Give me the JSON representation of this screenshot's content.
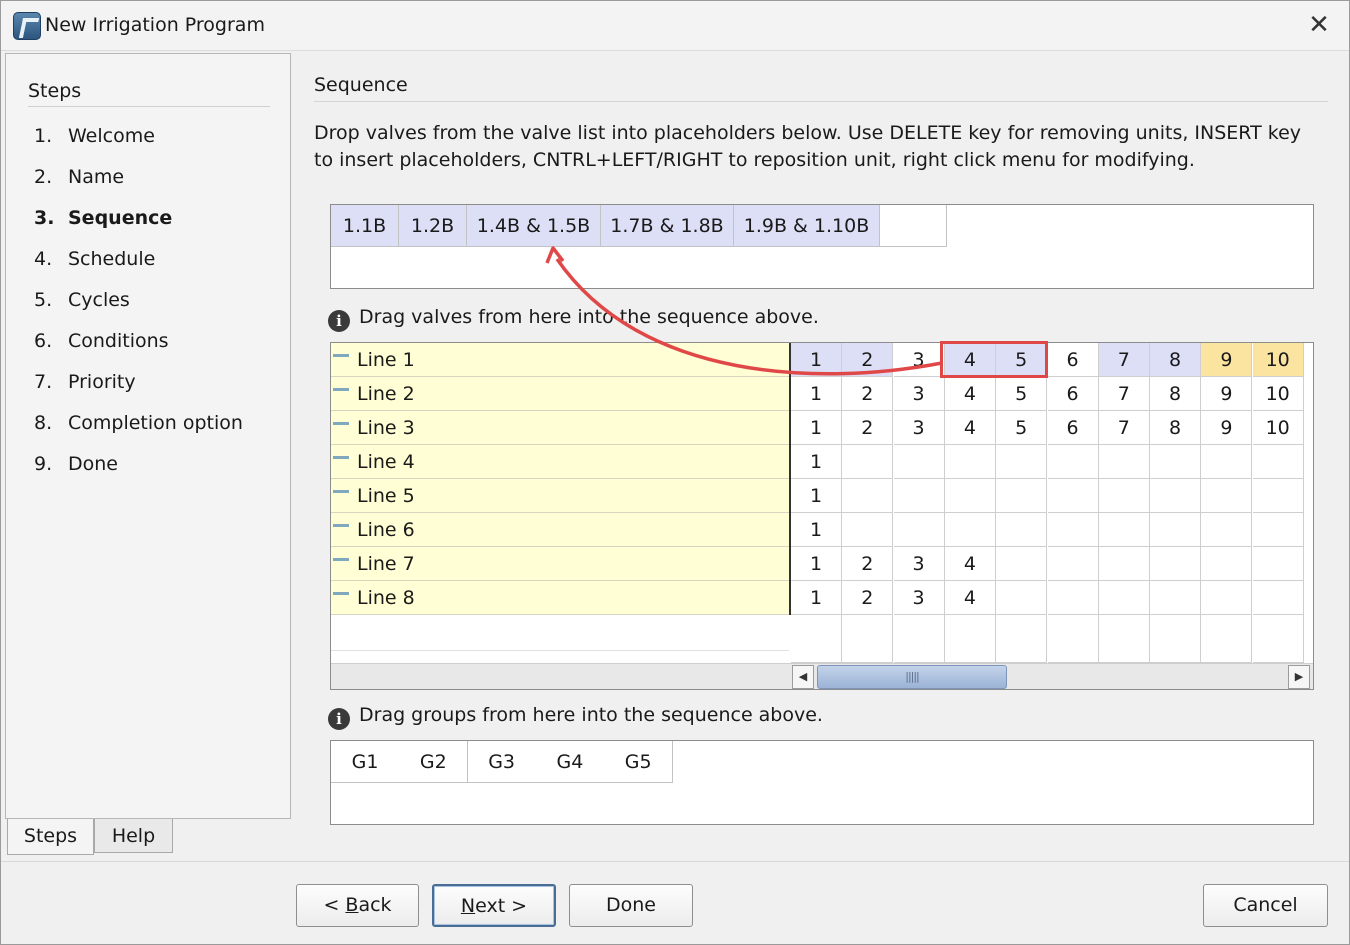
{
  "window": {
    "title": "New Irrigation Program",
    "close_glyph": "✕"
  },
  "steps_panel": {
    "title": "Steps",
    "items": [
      {
        "num": "1.",
        "label": "Welcome"
      },
      {
        "num": "2.",
        "label": "Name"
      },
      {
        "num": "3.",
        "label": "Sequence"
      },
      {
        "num": "4.",
        "label": "Schedule"
      },
      {
        "num": "5.",
        "label": "Cycles"
      },
      {
        "num": "6.",
        "label": "Conditions"
      },
      {
        "num": "7.",
        "label": "Priority"
      },
      {
        "num": "8.",
        "label": "Completion option"
      },
      {
        "num": "9.",
        "label": "Done"
      }
    ],
    "active_index": 2,
    "tabs": [
      "Steps",
      "Help"
    ]
  },
  "main": {
    "section_title": "Sequence",
    "instructions_line1": "Drop valves from the valve list into placeholders below. Use DELETE key for removing units, INSERT key",
    "instructions_line2": "to insert placeholders, CNTRL+LEFT/RIGHT to reposition unit, right click menu for modifying.",
    "sequence": [
      "1.1B",
      "1.2B",
      "1.4B & 1.5B",
      "1.7B & 1.8B",
      "1.9B & 1.10B",
      ""
    ],
    "valves_hint": "Drag valves from here into the sequence above.",
    "lines": [
      {
        "name": "Line 1",
        "cells": [
          "1",
          "2",
          "3",
          "4",
          "5",
          "6",
          "7",
          "8",
          "9",
          "10"
        ]
      },
      {
        "name": "Line 2",
        "cells": [
          "1",
          "2",
          "3",
          "4",
          "5",
          "6",
          "7",
          "8",
          "9",
          "10"
        ]
      },
      {
        "name": "Line 3",
        "cells": [
          "1",
          "2",
          "3",
          "4",
          "5",
          "6",
          "7",
          "8",
          "9",
          "10"
        ]
      },
      {
        "name": "Line 4",
        "cells": [
          "1",
          "",
          "",
          "",
          "",
          "",
          "",
          "",
          "",
          ""
        ]
      },
      {
        "name": "Line 5",
        "cells": [
          "1",
          "",
          "",
          "",
          "",
          "",
          "",
          "",
          "",
          ""
        ]
      },
      {
        "name": "Line 6",
        "cells": [
          "1",
          "",
          "",
          "",
          "",
          "",
          "",
          "",
          "",
          ""
        ]
      },
      {
        "name": "Line 7",
        "cells": [
          "1",
          "2",
          "3",
          "4",
          "",
          "",
          "",
          "",
          "",
          ""
        ]
      },
      {
        "name": "Line 8",
        "cells": [
          "1",
          "2",
          "3",
          "4",
          "",
          "",
          "",
          "",
          "",
          ""
        ]
      }
    ],
    "line1_cell_states": [
      "used",
      "used",
      "plain",
      "used",
      "used",
      "plain",
      "used",
      "used",
      "selected",
      "selected"
    ],
    "scroll_left_glyph": "◀",
    "scroll_right_glyph": "▶",
    "scroll_grip": "|||||",
    "groups_hint": "Drag groups from here into the sequence above.",
    "groups": [
      "G1",
      "G2",
      "G3",
      "G4",
      "G5"
    ]
  },
  "footer": {
    "back_label": "< Back",
    "next_label": "Next >",
    "done_label": "Done",
    "cancel_label": "Cancel"
  },
  "colors": {
    "used_cell": "#dcdff6",
    "selected_cell": "#fbe3a0",
    "line_name_bg": "#fffed4",
    "annotation": "#e04848"
  }
}
